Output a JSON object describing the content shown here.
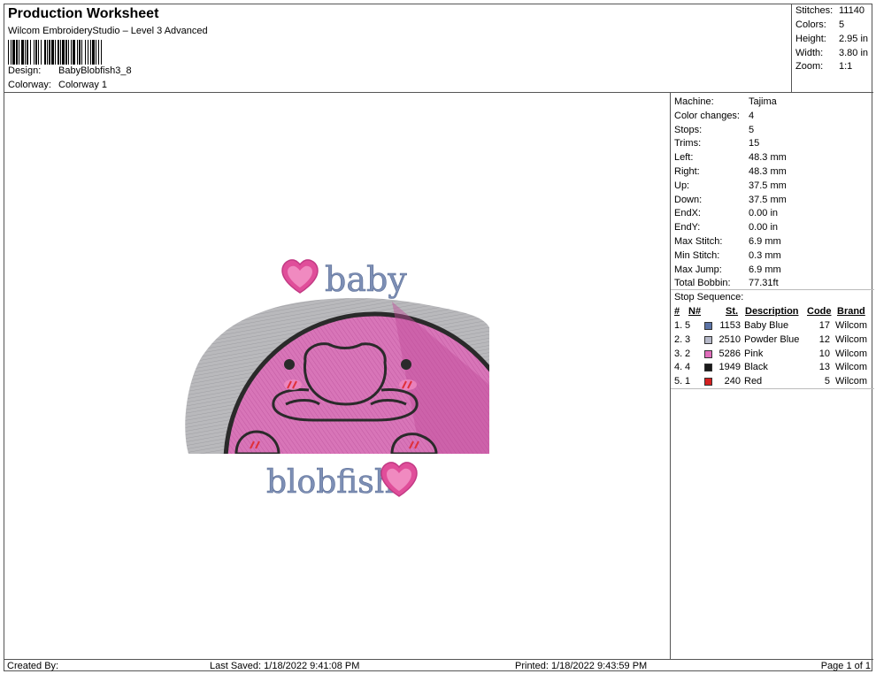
{
  "header": {
    "title": "Production Worksheet",
    "software": "Wilcom EmbroideryStudio – Level 3 Advanced",
    "design_label": "Design:",
    "design_value": "BabyBlobfish3_8",
    "colorway_label": "Colorway:",
    "colorway_value": "Colorway 1"
  },
  "stats": [
    {
      "label": "Stitches:",
      "value": "11140"
    },
    {
      "label": "Colors:",
      "value": "5"
    },
    {
      "label": "Height:",
      "value": "2.95 in"
    },
    {
      "label": "Width:",
      "value": "3.80 in"
    },
    {
      "label": "Zoom:",
      "value": "1:1"
    }
  ],
  "machine_info": [
    {
      "label": "Machine:",
      "value": "Tajima"
    },
    {
      "label": "Color changes:",
      "value": "4"
    },
    {
      "label": "Stops:",
      "value": "5"
    },
    {
      "label": "Trims:",
      "value": "15"
    },
    {
      "label": "Left:",
      "value": "48.3 mm"
    },
    {
      "label": "Right:",
      "value": "48.3 mm"
    },
    {
      "label": "Up:",
      "value": "37.5 mm"
    },
    {
      "label": "Down:",
      "value": "37.5 mm"
    },
    {
      "label": "EndX:",
      "value": "0.00 in"
    },
    {
      "label": "EndY:",
      "value": "0.00 in"
    },
    {
      "label": "Max Stitch:",
      "value": "6.9 mm"
    },
    {
      "label": "Min Stitch:",
      "value": "0.3 mm"
    },
    {
      "label": "Max Jump:",
      "value": "6.9 mm"
    },
    {
      "label": "Total Bobbin:",
      "value": "77.31ft"
    }
  ],
  "stop_sequence": {
    "title": "Stop Sequence:",
    "headers": {
      "num": "#",
      "n": "N#",
      "st": "St.",
      "desc": "Description",
      "code": "Code",
      "brand": "Brand"
    },
    "rows": [
      {
        "num": "1.",
        "n": "5",
        "color": "#5b73a6",
        "st": "1153",
        "desc": "Baby Blue",
        "code": "17",
        "brand": "Wilcom"
      },
      {
        "num": "2.",
        "n": "3",
        "color": "#b6b9c9",
        "st": "2510",
        "desc": "Powder Blue",
        "code": "12",
        "brand": "Wilcom"
      },
      {
        "num": "3.",
        "n": "2",
        "color": "#e06dbb",
        "st": "5286",
        "desc": "Pink",
        "code": "10",
        "brand": "Wilcom"
      },
      {
        "num": "4.",
        "n": "4",
        "color": "#1a1a1a",
        "st": "1949",
        "desc": "Black",
        "code": "13",
        "brand": "Wilcom"
      },
      {
        "num": "5.",
        "n": "1",
        "color": "#d42020",
        "st": "240",
        "desc": "Red",
        "code": "5",
        "brand": "Wilcom"
      }
    ]
  },
  "artwork": {
    "top_text": "baby",
    "bottom_text": "blobfish",
    "colors": {
      "text": "#7d8fb5",
      "pink": "#d873b6",
      "heart": "#e04e9a",
      "gray": "#b5b5b8",
      "outline": "#2a2a2a",
      "blush": "#e0303a"
    }
  },
  "footer": {
    "created_by": "Created By:",
    "last_saved": "Last Saved: 1/18/2022 9:41:08 PM",
    "printed": "Printed: 1/18/2022 9:43:59 PM",
    "page": "Page 1 of 1"
  }
}
